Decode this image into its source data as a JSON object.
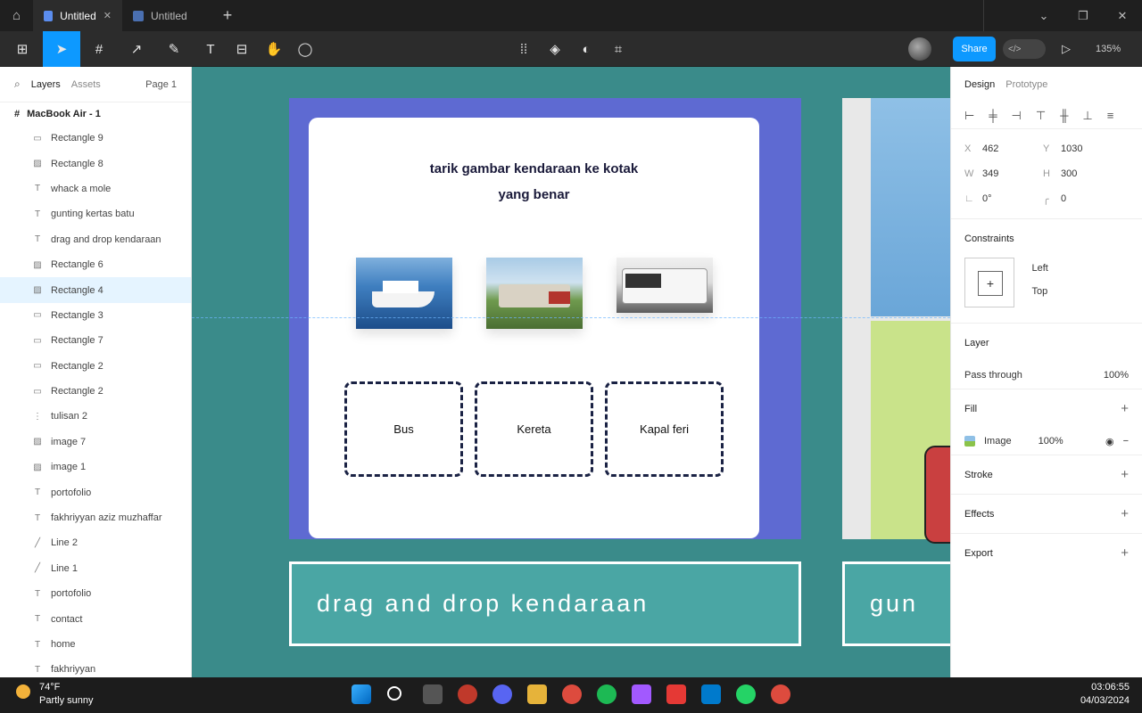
{
  "titlebar": {
    "tabs": [
      {
        "label": "Untitled",
        "active": true
      },
      {
        "label": "Untitled",
        "active": false
      }
    ]
  },
  "toolbar": {
    "share_label": "Share",
    "zoom": "135%"
  },
  "layers_panel": {
    "tab_layers": "Layers",
    "tab_assets": "Assets",
    "page": "Page 1",
    "frame": "MacBook Air - 1",
    "items": [
      {
        "label": "Rectangle 9",
        "icon": "rectangle"
      },
      {
        "label": "Rectangle 8",
        "icon": "image"
      },
      {
        "label": "whack a mole",
        "icon": "text"
      },
      {
        "label": "gunting kertas batu",
        "icon": "text"
      },
      {
        "label": "drag and drop kendaraan",
        "icon": "text"
      },
      {
        "label": "Rectangle 6",
        "icon": "image"
      },
      {
        "label": "Rectangle 4",
        "icon": "image",
        "selected": true
      },
      {
        "label": "Rectangle 3",
        "icon": "rectangle"
      },
      {
        "label": "Rectangle 7",
        "icon": "rectangle"
      },
      {
        "label": "Rectangle 2",
        "icon": "rectangle"
      },
      {
        "label": "Rectangle 2",
        "icon": "rectangle"
      },
      {
        "label": "tulisan 2",
        "icon": "frame"
      },
      {
        "label": "image 7",
        "icon": "image"
      },
      {
        "label": "image 1",
        "icon": "image"
      },
      {
        "label": "portofolio",
        "icon": "text"
      },
      {
        "label": "fakhriyyan aziz muzhaffar",
        "icon": "text"
      },
      {
        "label": "Line 2",
        "icon": "line"
      },
      {
        "label": "Line 1",
        "icon": "line"
      },
      {
        "label": "portofolio",
        "icon": "text"
      },
      {
        "label": "contact",
        "icon": "text"
      },
      {
        "label": "home",
        "icon": "text"
      },
      {
        "label": "fakhriyyan",
        "icon": "text"
      }
    ]
  },
  "canvas": {
    "instruction_line1": "tarik gambar kendaraan ke kotak",
    "instruction_line2": "yang benar",
    "dropzones": [
      "Bus",
      "Kereta",
      "Kapal feri"
    ],
    "banner1": "drag and drop kendaraan",
    "banner2": "gun",
    "colors": {
      "canvas_bg": "#3a8b8a",
      "frame_bg": "#5e6ad2",
      "banner_bg": "#4aa6a4"
    }
  },
  "design_panel": {
    "tab_design": "Design",
    "tab_prototype": "Prototype",
    "x": "462",
    "y": "1030",
    "w": "349",
    "h": "300",
    "rotation": "0°",
    "radius": "0",
    "constraints_title": "Constraints",
    "constraint_h": "Left",
    "constraint_v": "Top",
    "layer_title": "Layer",
    "blend": "Pass through",
    "layer_opacity": "100%",
    "fill_title": "Fill",
    "fill_type": "Image",
    "fill_opacity": "100%",
    "stroke_title": "Stroke",
    "effects_title": "Effects",
    "export_title": "Export"
  },
  "taskbar": {
    "temperature": "74°F",
    "weather": "Partly sunny",
    "time": "03:06:55",
    "date": "04/03/2024"
  }
}
